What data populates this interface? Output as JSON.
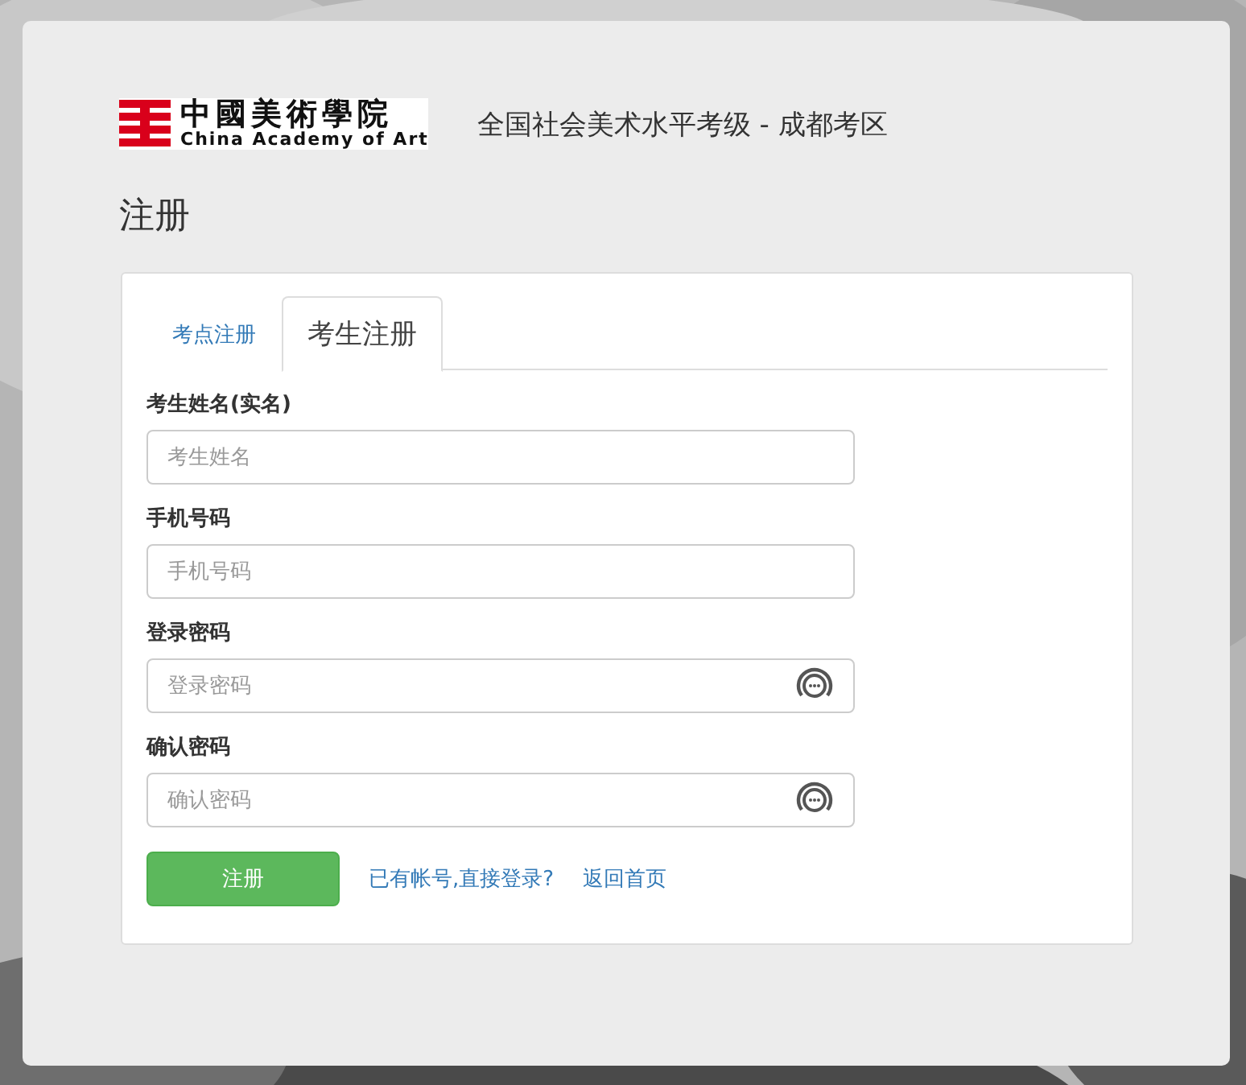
{
  "logo": {
    "name_cn": "中國美術學院",
    "name_en": "China Academy of Art"
  },
  "site_title": "全国社会美术水平考级 - 成都考区",
  "page_title": "注册",
  "tabs": [
    {
      "label": "考点注册",
      "selected": false
    },
    {
      "label": "考生注册",
      "selected": true
    }
  ],
  "fields": [
    {
      "label": "考生姓名(实名)",
      "placeholder": "考生姓名",
      "kind": "text"
    },
    {
      "label": "手机号码",
      "placeholder": "手机号码",
      "kind": "text"
    },
    {
      "label": "登录密码",
      "placeholder": "登录密码",
      "kind": "password"
    },
    {
      "label": "确认密码",
      "placeholder": "确认密码",
      "kind": "password"
    }
  ],
  "submit": "注册",
  "links": [
    "已有帐号,直接登录?",
    "返回首页"
  ]
}
